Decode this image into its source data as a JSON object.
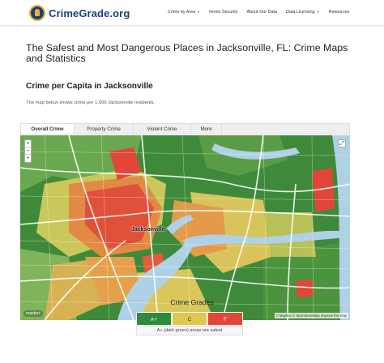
{
  "header": {
    "logo_text": "CrimeGrade.org",
    "nav": [
      {
        "label": "Crime by Area",
        "dropdown": true
      },
      {
        "label": "Home Security",
        "dropdown": false
      },
      {
        "label": "About Our Data",
        "dropdown": false
      },
      {
        "label": "Data Licensing",
        "dropdown": true
      },
      {
        "label": "Resources",
        "dropdown": false
      }
    ]
  },
  "main": {
    "page_title": "The Safest and Most Dangerous Places in Jacksonville, FL: Crime Maps and Statistics",
    "section_title": "Crime per Capita in Jacksonville",
    "section_desc": "The map below shows crime per 1,000 Jacksonville residents."
  },
  "tabs": [
    {
      "label": "Overall Crime",
      "active": true
    },
    {
      "label": "Property Crime",
      "active": false
    },
    {
      "label": "Violent Crime",
      "active": false
    },
    {
      "label": "More",
      "active": false
    }
  ],
  "map": {
    "zoom_in": "+",
    "zoom_out": "−",
    "zoom_reset": "•",
    "fullscreen_icon": "⤢",
    "city_label": "Jacksonville",
    "mapbox_logo": "mapbox",
    "attribution": "© Mapbox © OpenStreetMap Improve this map"
  },
  "legend": {
    "title": "Crime Grades",
    "grades": [
      {
        "label": "A+",
        "color": "#2e8b3e"
      },
      {
        "label": "C",
        "color": "#e0c84c"
      },
      {
        "label": "F",
        "color": "#e2463a"
      }
    ],
    "note": "A+ (dark green) areas are safest"
  },
  "colors": {
    "brand": "#1d3f7a",
    "accent": "#e8b43a",
    "water": "#aed1e6",
    "safe": "#2e8b3e",
    "moderate": "#e0c84c",
    "dangerous": "#e2463a"
  }
}
